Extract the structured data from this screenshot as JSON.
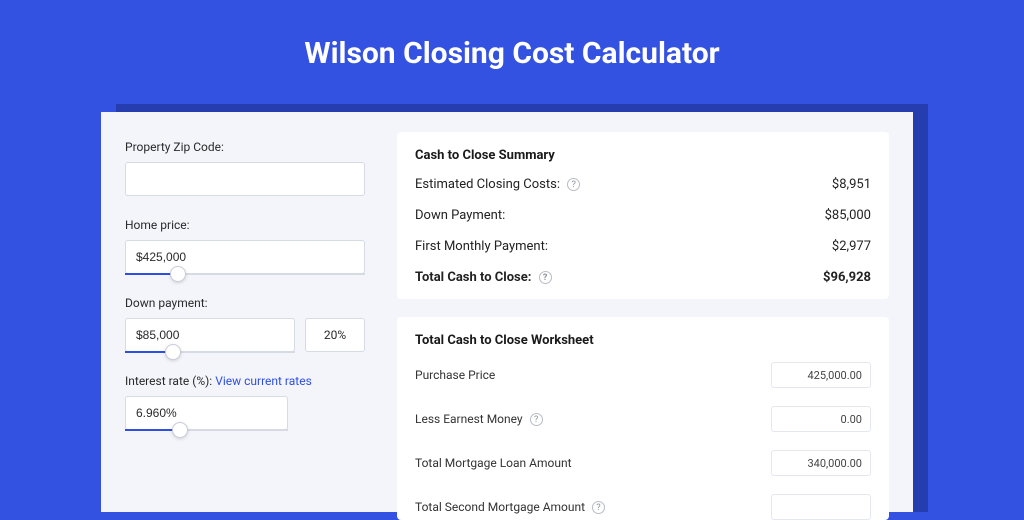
{
  "title": "Wilson Closing Cost Calculator",
  "form": {
    "zip_label": "Property Zip Code:",
    "zip_value": "",
    "home_price_label": "Home price:",
    "home_price_value": "$425,000",
    "home_price_slider_pct": 22,
    "down_payment_label": "Down payment:",
    "down_payment_value": "$85,000",
    "down_payment_pct": "20%",
    "down_payment_slider_pct": 28,
    "interest_label": "Interest rate (%):",
    "interest_link": "View current rates",
    "interest_value": "6.960%",
    "interest_slider_pct": 34
  },
  "summary": {
    "title": "Cash to Close Summary",
    "rows": [
      {
        "label": "Estimated Closing Costs:",
        "help": true,
        "value": "$8,951"
      },
      {
        "label": "Down Payment:",
        "help": false,
        "value": "$85,000"
      },
      {
        "label": "First Monthly Payment:",
        "help": false,
        "value": "$2,977"
      }
    ],
    "total_label": "Total Cash to Close:",
    "total_value": "$96,928"
  },
  "worksheet": {
    "title": "Total Cash to Close Worksheet",
    "rows": [
      {
        "label": "Purchase Price",
        "help": false,
        "value": "425,000.00"
      },
      {
        "label": "Less Earnest Money",
        "help": true,
        "value": "0.00"
      },
      {
        "label": "Total Mortgage Loan Amount",
        "help": false,
        "value": "340,000.00"
      },
      {
        "label": "Total Second Mortgage Amount",
        "help": true,
        "value": ""
      }
    ]
  }
}
